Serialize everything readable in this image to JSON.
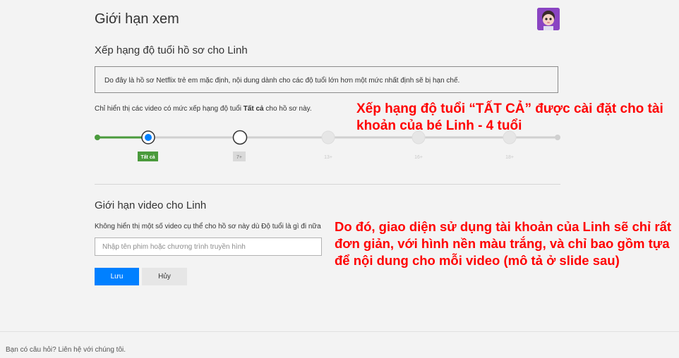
{
  "header": {
    "title": "Giới hạn xem"
  },
  "rating": {
    "section_title": "Xếp hạng độ tuổi hồ sơ cho Linh",
    "notice": "Do đây là hồ sơ Netflix trẻ em mặc định, nội dung dành cho các độ tuổi lớn hơn một mức nhất định sẽ bị hạn chế.",
    "desc_prefix": "Chỉ hiển thị các video có mức xếp hạng độ tuổi ",
    "desc_bold": "Tất cả",
    "desc_suffix": " cho hồ sơ này.",
    "levels": [
      "Tất cả",
      "7+",
      "13+",
      "16+",
      "18+"
    ],
    "selected_level": "Tất cả",
    "colors": {
      "active": "#4a9a3c",
      "selected_dot": "#0080ff",
      "track": "#d0d0d0"
    }
  },
  "block": {
    "section_title": "Giới hạn video cho Linh",
    "desc": "Không hiển thị một số video cụ thể cho hồ sơ này dù Độ tuổi là gì đi nữa",
    "placeholder": "Nhập tên phim hoặc chương trình truyền hình"
  },
  "buttons": {
    "save": "Lưu",
    "cancel": "Hủy"
  },
  "footer": {
    "text": "Bạn có câu hỏi? Liên hệ với chúng tôi."
  },
  "annotations": {
    "first": "Xếp hạng độ tuổi “TẤT CẢ” được cài đặt cho tài khoản của bé Linh - 4 tuổi",
    "second": "Do đó, giao diện sử dụng tài khoản của Linh sẽ chỉ rất đơn giản, với hình nền màu trắng, và chỉ bao gồm tựa để nội dung cho mỗi video (mô tả ở slide sau)"
  }
}
